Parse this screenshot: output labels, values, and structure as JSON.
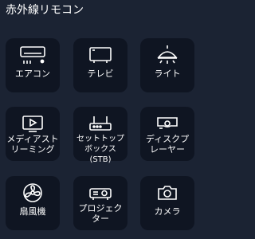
{
  "header": {
    "title": "赤外線リモコン"
  },
  "devices": [
    {
      "label": "エアコン",
      "icon": "air-conditioner-icon"
    },
    {
      "label": "テレビ",
      "icon": "tv-icon"
    },
    {
      "label": "ライト",
      "icon": "light-icon"
    },
    {
      "label": "メディアスト\nリーミング",
      "icon": "media-streaming-icon"
    },
    {
      "label": "セットトップ\nボックス(STB)",
      "icon": "set-top-box-icon"
    },
    {
      "label": "ディスクプ\nレーヤー",
      "icon": "disc-player-icon"
    },
    {
      "label": "扇風機",
      "icon": "fan-icon"
    },
    {
      "label": "プロジェク\nター",
      "icon": "projector-icon"
    },
    {
      "label": "カメラ",
      "icon": "camera-icon"
    }
  ],
  "colors": {
    "background": "#1b2333",
    "tile": "#0f1522",
    "text": "#ffffff"
  }
}
